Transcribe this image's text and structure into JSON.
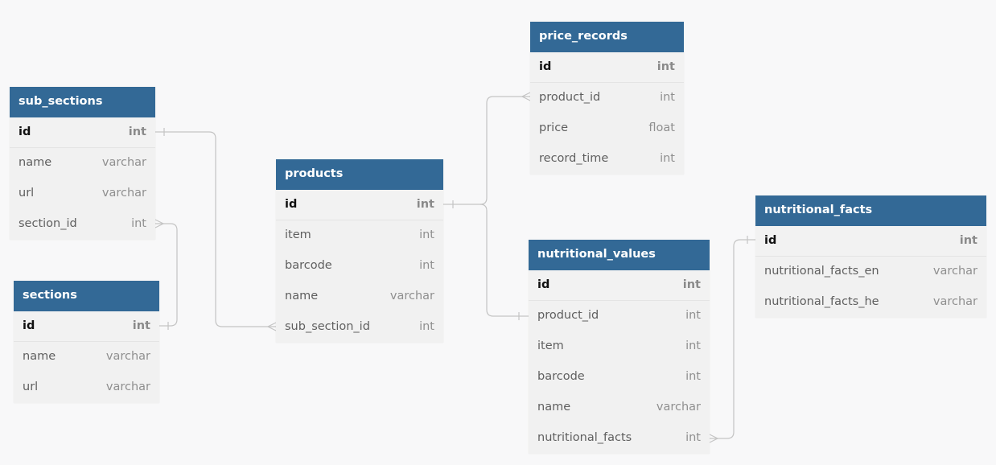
{
  "theme": {
    "header_color": "#336996",
    "canvas_bg": "#f8f8f9",
    "line_color": "#c4c4c4"
  },
  "tables": {
    "sub_sections": {
      "name": "sub_sections",
      "columns": [
        {
          "name": "id",
          "type": "int"
        },
        {
          "name": "name",
          "type": "varchar"
        },
        {
          "name": "url",
          "type": "varchar"
        },
        {
          "name": "section_id",
          "type": "int"
        }
      ]
    },
    "sections": {
      "name": "sections",
      "columns": [
        {
          "name": "id",
          "type": "int"
        },
        {
          "name": "name",
          "type": "varchar"
        },
        {
          "name": "url",
          "type": "varchar"
        }
      ]
    },
    "products": {
      "name": "products",
      "columns": [
        {
          "name": "id",
          "type": "int"
        },
        {
          "name": "item",
          "type": "int"
        },
        {
          "name": "barcode",
          "type": "int"
        },
        {
          "name": "name",
          "type": "varchar"
        },
        {
          "name": "sub_section_id",
          "type": "int"
        }
      ]
    },
    "price_records": {
      "name": "price_records",
      "columns": [
        {
          "name": "id",
          "type": "int"
        },
        {
          "name": "product_id",
          "type": "int"
        },
        {
          "name": "price",
          "type": "float"
        },
        {
          "name": "record_time",
          "type": "int"
        }
      ]
    },
    "nutritional_values": {
      "name": "nutritional_values",
      "columns": [
        {
          "name": "id",
          "type": "int"
        },
        {
          "name": "product_id",
          "type": "int"
        },
        {
          "name": "item",
          "type": "int"
        },
        {
          "name": "barcode",
          "type": "int"
        },
        {
          "name": "name",
          "type": "varchar"
        },
        {
          "name": "nutritional_facts",
          "type": "int"
        }
      ]
    },
    "nutritional_facts": {
      "name": "nutritional_facts",
      "columns": [
        {
          "name": "id",
          "type": "int"
        },
        {
          "name": "nutritional_facts_en",
          "type": "varchar"
        },
        {
          "name": "nutritional_facts_he",
          "type": "varchar"
        }
      ]
    }
  },
  "relationships": [
    {
      "from": "sub_sections.id",
      "to": "products.sub_section_id",
      "type": "one-to-many"
    },
    {
      "from": "sections.id",
      "to": "sub_sections.section_id",
      "type": "one-to-many"
    },
    {
      "from": "products.id",
      "to": "price_records.product_id",
      "type": "one-to-many"
    },
    {
      "from": "products.id",
      "to": "nutritional_values.product_id",
      "type": "one-to-one"
    },
    {
      "from": "nutritional_facts.id",
      "to": "nutritional_values.nutritional_facts",
      "type": "one-to-many"
    }
  ]
}
